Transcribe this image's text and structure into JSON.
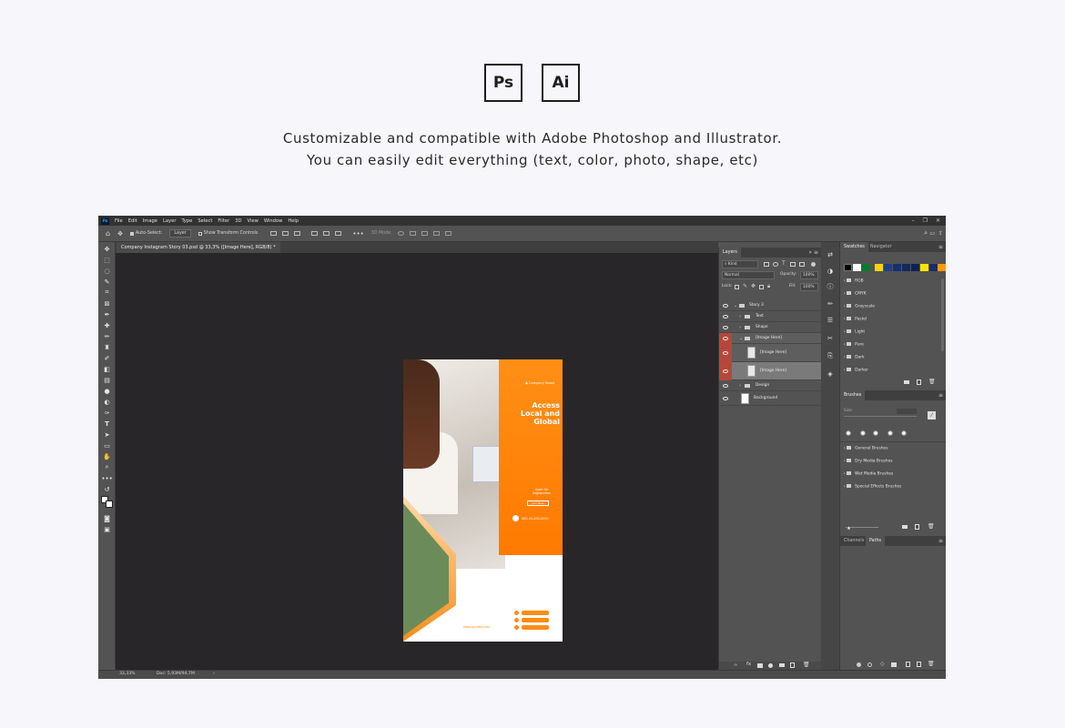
{
  "hero": {
    "ps_badge": "Ps",
    "ai_badge": "Ai",
    "line1": "Customizable and compatible with Adobe Photoshop and Illustrator.",
    "line2": "You can easily edit everything (text, color, photo, shape, etc)"
  },
  "app": {
    "logo": "Ps",
    "menu": [
      "File",
      "Edit",
      "Image",
      "Layer",
      "Type",
      "Select",
      "Filter",
      "3D",
      "View",
      "Window",
      "Help"
    ],
    "options": {
      "auto_select": "Auto-Select:",
      "layer_select": "Layer",
      "show_transform": "Show Transform Controls",
      "mode_3d": "3D Mode:"
    },
    "doc_tab": "Company Instagram Story 03.psd @ 33,3% ([Image Here], RGB/8) *",
    "status": {
      "zoom": "33,33%",
      "doc": "Doc: 5,93M/94,7M"
    }
  },
  "artboard": {
    "logo_line": "Company Name",
    "heading": "Access Local and Global",
    "open_for": "Open for Registration",
    "cta": "Join Now",
    "phone": "000-00-000-0000",
    "website": "www.yoursite.com"
  },
  "layers": {
    "tab": "Layers",
    "kind": "Kind",
    "blend": "Normal",
    "opacity_label": "Opacity:",
    "opacity": "100%",
    "lock_label": "Lock:",
    "fill_label": "Fill:",
    "fill": "100%",
    "items": [
      {
        "name": "Story 3"
      },
      {
        "name": "Text"
      },
      {
        "name": "Shape"
      },
      {
        "name": "[Image Here]"
      },
      {
        "name": "[Image Here]"
      },
      {
        "name": "[Image Here]"
      },
      {
        "name": "Design"
      },
      {
        "name": "Background"
      }
    ]
  },
  "swatches": {
    "tab1": "Swatches",
    "tab2": "Navigator",
    "colors": [
      "#000000",
      "#ffffff",
      "#0a7b2e",
      "#ffd400",
      "#1d3f8a",
      "#16306d",
      "#132a5e",
      "#0e2151",
      "#f5e400",
      "#1d2a68",
      "#ff9900"
    ],
    "groups": [
      "RGB",
      "CMYK",
      "Grayscale",
      "Pastel",
      "Light",
      "Pure",
      "Dark",
      "Darker"
    ]
  },
  "brushes": {
    "tab": "Brushes",
    "size_label": "Size:",
    "groups": [
      "General Brushes",
      "Dry Media Brushes",
      "Wet Media Brushes",
      "Special Effects Brushes"
    ]
  },
  "bottom_tabs": {
    "channels": "Channels",
    "paths": "Paths"
  }
}
